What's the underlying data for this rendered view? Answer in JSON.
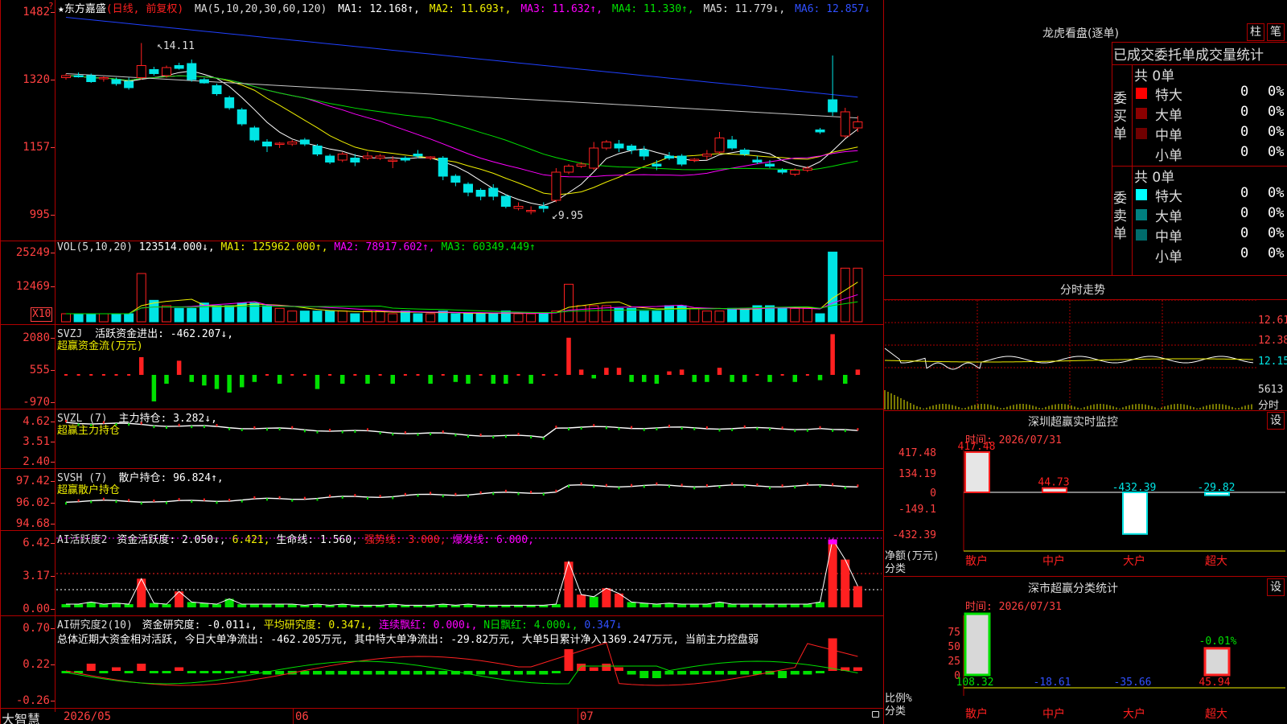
{
  "colors": {
    "up": "#ff2020",
    "down": "#00e5e5",
    "bg": "#000000",
    "grid": "#b00000",
    "axis": "#ff4040",
    "green": "#00e000",
    "white": "#ffffff",
    "yellow": "#f0f000",
    "magenta": "#ff00ff"
  },
  "header": {
    "indicator_star": "?",
    "name_prefix": "★",
    "name": "东方嘉盛",
    "name_suffix": "(日线, 前复权)",
    "ma_label": "MA(5,10,20,30,60,120)",
    "ma1": "MA1: 12.168↑,",
    "ma2": "MA2: 11.693↑,",
    "ma3": "MA3: 11.632↑,",
    "ma4": "MA4: 11.330↑,",
    "ma5": "MA5: 11.779↓,",
    "ma6": "MA6: 12.857↓"
  },
  "price_axis": [
    "1482",
    "1320",
    "1157",
    "995"
  ],
  "price_marks": {
    "high": "14.11",
    "low": "9.95"
  },
  "price_chart": {
    "ylim": [
      9.3,
      15.1
    ],
    "candles": [
      [
        13.25,
        13.35,
        13.2,
        13.3
      ],
      [
        13.3,
        13.38,
        13.25,
        13.28
      ],
      [
        13.3,
        13.35,
        13.12,
        13.15
      ],
      [
        13.22,
        13.28,
        13.15,
        13.25
      ],
      [
        13.2,
        13.25,
        13.05,
        13.1
      ],
      [
        13.15,
        13.25,
        12.95,
        13.0
      ],
      [
        13.25,
        14.11,
        13.2,
        13.55
      ],
      [
        13.45,
        13.52,
        13.3,
        13.35
      ],
      [
        13.3,
        13.55,
        13.25,
        13.5
      ],
      [
        13.55,
        13.62,
        13.45,
        13.48
      ],
      [
        13.6,
        13.7,
        13.15,
        13.2
      ],
      [
        13.2,
        13.25,
        13.1,
        13.12
      ],
      [
        13.05,
        13.1,
        12.8,
        12.85
      ],
      [
        12.75,
        12.8,
        12.45,
        12.5
      ],
      [
        12.45,
        12.5,
        12.05,
        12.1
      ],
      [
        12.0,
        12.05,
        11.65,
        11.7
      ],
      [
        11.65,
        11.72,
        11.4,
        11.55
      ],
      [
        11.6,
        11.65,
        11.5,
        11.62
      ],
      [
        11.6,
        11.7,
        11.55,
        11.65
      ],
      [
        11.7,
        11.75,
        11.55,
        11.6
      ],
      [
        11.55,
        11.6,
        11.3,
        11.35
      ],
      [
        11.3,
        11.35,
        11.1,
        11.15
      ],
      [
        11.2,
        11.4,
        11.15,
        11.35
      ],
      [
        11.25,
        11.35,
        11.05,
        11.15
      ],
      [
        11.25,
        11.4,
        11.2,
        11.3
      ],
      [
        11.25,
        11.35,
        11.2,
        11.3
      ],
      [
        11.2,
        11.3,
        11.0,
        11.2
      ],
      [
        11.25,
        11.3,
        11.15,
        11.2
      ],
      [
        11.35,
        11.45,
        11.25,
        11.3
      ],
      [
        11.25,
        11.3,
        11.2,
        11.28
      ],
      [
        11.25,
        11.3,
        10.7,
        10.8
      ],
      [
        10.8,
        10.85,
        10.55,
        10.65
      ],
      [
        10.6,
        10.65,
        10.3,
        10.4
      ],
      [
        10.45,
        10.5,
        10.2,
        10.3
      ],
      [
        10.5,
        10.6,
        10.2,
        10.3
      ],
      [
        10.3,
        10.35,
        10.0,
        10.05
      ],
      [
        10.0,
        10.15,
        9.95,
        10.05
      ],
      [
        9.95,
        10.05,
        9.85,
        9.95
      ],
      [
        10.05,
        10.15,
        9.9,
        10.0
      ],
      [
        10.2,
        11.0,
        10.15,
        10.9
      ],
      [
        10.9,
        11.1,
        10.85,
        11.05
      ],
      [
        11.05,
        11.15,
        11.0,
        11.1
      ],
      [
        11.0,
        11.65,
        10.95,
        11.5
      ],
      [
        11.5,
        11.7,
        11.45,
        11.65
      ],
      [
        11.6,
        11.7,
        11.4,
        11.5
      ],
      [
        11.55,
        11.6,
        11.35,
        11.45
      ],
      [
        11.45,
        11.55,
        11.2,
        11.3
      ],
      [
        11.1,
        11.2,
        10.95,
        11.05
      ],
      [
        11.3,
        11.4,
        11.2,
        11.25
      ],
      [
        11.3,
        11.35,
        11.05,
        11.1
      ],
      [
        11.2,
        11.25,
        11.15,
        11.22
      ],
      [
        11.3,
        11.45,
        11.2,
        11.35
      ],
      [
        11.4,
        11.9,
        11.35,
        11.75
      ],
      [
        11.7,
        11.8,
        11.45,
        11.5
      ],
      [
        11.45,
        11.5,
        11.3,
        11.35
      ],
      [
        11.2,
        11.3,
        11.1,
        11.15
      ],
      [
        11.1,
        11.2,
        11.0,
        11.05
      ],
      [
        10.95,
        11.0,
        10.85,
        10.9
      ],
      [
        10.85,
        11.0,
        10.8,
        10.95
      ],
      [
        10.95,
        11.05,
        10.9,
        11.0
      ],
      [
        11.95,
        12.0,
        11.85,
        11.9
      ],
      [
        12.7,
        13.8,
        12.3,
        12.4
      ],
      [
        11.8,
        12.5,
        11.75,
        12.4
      ],
      [
        12.0,
        12.3,
        11.9,
        12.15
      ]
    ]
  },
  "vol_header": {
    "label": "VOL(5,10,20)",
    "value": "123514.000↓,",
    "ma1": "MA1: 125962.000↑,",
    "ma2": "MA2: 78917.602↑,",
    "ma3": "MA3: 60349.449↑"
  },
  "vol_axis": [
    "25249",
    "12469"
  ],
  "vol_unit": "X10",
  "vol_values": [
    3,
    3,
    3,
    3,
    3,
    3,
    18,
    8,
    6,
    5,
    5,
    7,
    6,
    6,
    7,
    7,
    6,
    5,
    4,
    4,
    4,
    4,
    4,
    3,
    4,
    4,
    3,
    4,
    3,
    3,
    4,
    3,
    3,
    3,
    3,
    4,
    3,
    3,
    3,
    4,
    14,
    6,
    6,
    6,
    5,
    5,
    4,
    4,
    6,
    6,
    5,
    4,
    4,
    5,
    5,
    6,
    6,
    5,
    5,
    5,
    3,
    26,
    20,
    20
  ],
  "svzj": {
    "label": "SVZJ",
    "title": "活跃资金进出:",
    "value": "-462.207↓,",
    "subtitle": "超赢资金流(万元)",
    "axis": [
      "2080",
      "555",
      "-970"
    ]
  },
  "svzj_values": [
    0,
    0,
    0,
    0,
    0,
    0,
    1,
    -1.5,
    -0.5,
    0.8,
    -0.4,
    -0.6,
    -0.8,
    -1.0,
    -0.7,
    -0.4,
    0,
    -0.5,
    0,
    0,
    -0.8,
    0,
    -0.5,
    0,
    -0.5,
    0,
    -0.5,
    0,
    0,
    -0.5,
    0,
    -0.4,
    -0.5,
    0,
    -0.5,
    -0.5,
    0,
    -0.5,
    0,
    0,
    2.1,
    0.3,
    -0.2,
    0.4,
    0.4,
    -0.4,
    -0.4,
    -0.5,
    0.2,
    0.3,
    -0.4,
    -0.4,
    0.4,
    -0.4,
    -0.4,
    0,
    -0.4,
    0,
    -0.4,
    0,
    -0.3,
    2.3,
    -0.5,
    0.3
  ],
  "svzl": {
    "label": "SVZL (7)",
    "title": "主力持仓:",
    "value": "3.282↓,",
    "subtitle": "超赢主力持仓",
    "axis": [
      "4.62",
      "3.51",
      "2.40"
    ]
  },
  "svsh": {
    "label": "SVSH (7)",
    "title": "散户持仓:",
    "value": "96.824↑,",
    "subtitle": "超赢散户持仓",
    "axis": [
      "97.42",
      "96.02",
      "94.68"
    ]
  },
  "ai1": {
    "label": "AI活跃度2",
    "title": "资金活跃度:",
    "value": "2.050↓,",
    "v2": "6.421,",
    "life": "生命线: 1.560,",
    "strong": "强势线: 3.000,",
    "burst": "爆发线: 6.000,",
    "axis": [
      "6.42",
      "3.17",
      "0.00"
    ]
  },
  "ai1_values": [
    0.3,
    0.3,
    0.5,
    0.3,
    0.4,
    0.3,
    2.7,
    0.4,
    0.3,
    1.5,
    0.5,
    0.4,
    0.3,
    0.8,
    0.3,
    0.3,
    0.3,
    0.3,
    0.3,
    0.2,
    0.3,
    0.2,
    0.3,
    0.2,
    0.2,
    0.2,
    0.3,
    0.2,
    0.2,
    0.2,
    0.3,
    0.2,
    0.3,
    0.2,
    0.2,
    0.2,
    0.2,
    0.2,
    0.2,
    0.3,
    4.3,
    1.2,
    1.0,
    1.8,
    1.3,
    0.5,
    0.4,
    0.3,
    0.4,
    0.3,
    0.3,
    0.3,
    0.5,
    0.3,
    0.3,
    0.3,
    0.3,
    0.3,
    0.3,
    0.3,
    0.5,
    6.4,
    4.5,
    2.0
  ],
  "ai2": {
    "label": "AI研究度2(10)",
    "title": "资金研究度:",
    "value": "-0.011↓,",
    "avg": "平均研究度: 0.347↓,",
    "red": "连续飘红: 0.000↓,",
    "nred": "N日飘红: 4.000↓,",
    "last": "0.347↓",
    "summary": "总体近期大资金相对活跃, 今日大单净流出: -462.205万元, 其中特大单净流出: -29.82万元, 大单5日累计净入1369.247万元, 当前主力控盘弱",
    "axis": [
      "0.70",
      "0.22",
      "-0.26"
    ]
  },
  "ai2_values": [
    0,
    0,
    0.1,
    0,
    0.05,
    0,
    0.1,
    0,
    0,
    0.05,
    0,
    0,
    0,
    0,
    0,
    0,
    -0.05,
    -0.05,
    -0.05,
    -0.05,
    -0.05,
    -0.05,
    -0.05,
    -0.05,
    -0.05,
    -0.05,
    -0.05,
    -0.05,
    -0.05,
    -0.05,
    -0.05,
    -0.05,
    -0.05,
    -0.05,
    -0.05,
    -0.05,
    -0.05,
    -0.05,
    -0.05,
    0,
    0.3,
    0.1,
    0.05,
    0.1,
    0.05,
    -0.05,
    -0.1,
    -0.1,
    -0.05,
    -0.05,
    -0.05,
    -0.05,
    -0.05,
    -0.05,
    -0.05,
    -0.05,
    -0.05,
    -0.1,
    -0.05,
    -0.05,
    0,
    0.45,
    0.05,
    0.05
  ],
  "footer": {
    "brand": "大智慧",
    "dates": [
      "2026/05",
      "06",
      "07"
    ]
  },
  "right": {
    "top_title": "龙虎看盘(逐单)",
    "btn1": "柱",
    "btn2": "笔",
    "tab_done": "已成交委托单",
    "tab_vol": "成交量统计",
    "buy_label": "委买单",
    "sell_label": "委卖单",
    "buy_total": "共 0单",
    "sell_total": "共 0单",
    "buy_rows": [
      {
        "name": "特大",
        "count": "0",
        "pct": "0%",
        "color": "#ff0000"
      },
      {
        "name": "大单",
        "count": "0",
        "pct": "0%",
        "color": "#8b0000"
      },
      {
        "name": "中单",
        "count": "0",
        "pct": "0%",
        "color": "#700000"
      },
      {
        "name": "小单",
        "count": "0",
        "pct": "0%",
        "color": ""
      }
    ],
    "sell_rows": [
      {
        "name": "特大",
        "count": "0",
        "pct": "0%",
        "color": "#00ffff"
      },
      {
        "name": "大单",
        "count": "0",
        "pct": "0%",
        "color": "#008080"
      },
      {
        "name": "中单",
        "count": "0",
        "pct": "0%",
        "color": "#006b6b"
      },
      {
        "name": "小单",
        "count": "0",
        "pct": "0%",
        "color": ""
      }
    ],
    "intraday_title": "分时走势",
    "intraday_axis": [
      "12.61",
      "12.38",
      "12.15"
    ],
    "intraday_vol": "5613",
    "intraday_unit": "分时",
    "monitor_title": "深圳超赢实时监控",
    "monitor_btn": "设",
    "monitor_time": "时间: 2026/07/31",
    "monitor_axis": [
      "417.48",
      "134.19",
      "0",
      "-149.1",
      "-432.39"
    ],
    "monitor_ylabel": "净额(万元)",
    "monitor_xlabel": "分类",
    "monitor_bars": [
      {
        "cat": "散户",
        "value": "417.48"
      },
      {
        "cat": "中户",
        "value": "44.73"
      },
      {
        "cat": "大户",
        "value": "-432.39"
      },
      {
        "cat": "超大",
        "value": "-29.82"
      }
    ],
    "class_title": "深市超赢分类统计",
    "class_btn": "设",
    "class_time": "时间: 2026/07/31",
    "class_axis": [
      "75",
      "50",
      "25",
      "0"
    ],
    "class_ylabel": "比例%",
    "class_xlabel": "分类",
    "class_bars": [
      {
        "cat": "散户",
        "value": "108.32",
        "top": ""
      },
      {
        "cat": "中户",
        "value": "-18.61",
        "top": ""
      },
      {
        "cat": "大户",
        "value": "-35.66",
        "top": ""
      },
      {
        "cat": "超大",
        "value": "45.94",
        "top": "-0.01%"
      }
    ]
  }
}
